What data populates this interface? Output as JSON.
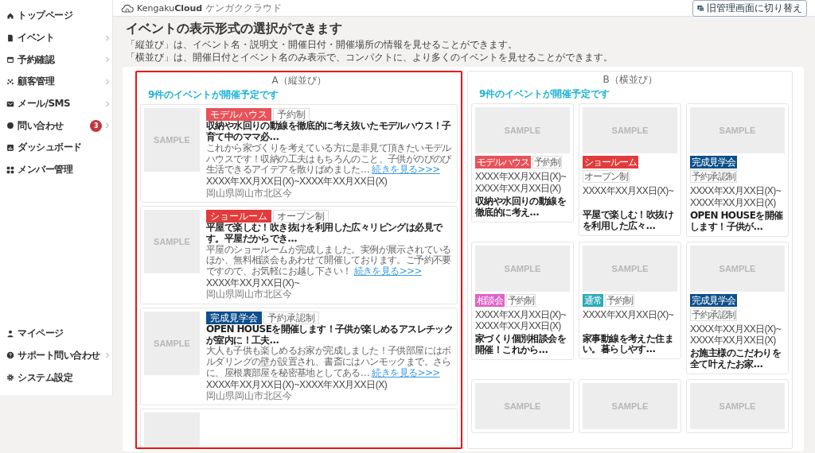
{
  "sidebar": {
    "items": [
      {
        "label": "トップページ",
        "expandable": false
      },
      {
        "label": "イベント",
        "expandable": true
      },
      {
        "label": "予約確認",
        "expandable": true
      },
      {
        "label": "顧客管理",
        "expandable": true
      },
      {
        "label": "メール/SMS",
        "expandable": true
      },
      {
        "label": "問い合わせ",
        "expandable": true,
        "badge": "3"
      },
      {
        "label": "ダッシュボード",
        "expandable": false
      },
      {
        "label": "メンバー管理",
        "expandable": false
      }
    ],
    "bottom_items": [
      {
        "label": "マイページ",
        "expandable": false
      },
      {
        "label": "サポート問い合わせ",
        "expandable": true
      },
      {
        "label": "システム設定",
        "expandable": false
      }
    ]
  },
  "header": {
    "logo": "Kengaku**Cloud**",
    "logo_sub": "ケンガククラウド",
    "switch_button": "旧管理画面に切り替え"
  },
  "page": {
    "title": "イベントの表示形式の選択ができます",
    "descriptions": [
      "「縦並び」は、イベント名・説明文・開催日付・開催場所の情報を見せることができます。",
      "「横並び」は、開催日付とイベント名のみ表示で、コンパクトに、より多くのイベントを見せることができます。"
    ]
  },
  "layouts": [
    {
      "kind": "vertical",
      "title": "A（縦並び）",
      "selected": true,
      "count_label": "9件のイベントが開催予定です",
      "cards": [
        {
          "image": {
            "kind": "placeholder",
            "label": "SAMPLE"
          },
          "tags": [
            {
              "kind": "filled",
              "label": "モデルハウス",
              "color": "#e8525a"
            },
            {
              "kind": "outline",
              "label": "予約制"
            }
          ],
          "title": "収納や水回りの動線を徹底的に考え抜いたモデルハウス！子育て中のママ必…",
          "description": "これから家づくりを考えている方に是非見て頂きたいモデルハウスです！収納の工夫はもちろんのこと、子供がのびのび生活できるアイデアを散りばめました…",
          "more_link": "続きを見る>>>",
          "dates": [
            "XXXX年XX月XX日(X)~XXXX年XX月XX日(X)"
          ],
          "place": "岡山県岡山市北区今"
        },
        {
          "image": {
            "kind": "placeholder",
            "label": "SAMPLE"
          },
          "tags": [
            {
              "kind": "filled",
              "label": "ショールーム",
              "color": "#e33b3b"
            },
            {
              "kind": "outline",
              "label": "オープン制"
            }
          ],
          "title": "平屋で楽しむ！吹き抜けを利用した広々リビングは必見です。平屋だからでき…",
          "description": "平屋のショールームが完成しました。実例が展示されているほか、無料相談会もあわせて開催しております。ご予約不要ですので、お気軽にお越し下さい！",
          "more_link": "続きを見る>>>",
          "dates": [
            "XXXX年XX月XX日(X)~"
          ],
          "place": "岡山県岡山市北区今"
        },
        {
          "image": {
            "kind": "placeholder",
            "label": "SAMPLE"
          },
          "tags": [
            {
              "kind": "filled",
              "label": "完成見学会",
              "color": "#0d4f8b"
            },
            {
              "kind": "outline",
              "label": "予約承認制"
            }
          ],
          "title": "OPEN HOUSEを開催します！子供が楽しめるアスレチックが室内に！工夫…",
          "description": "大人も子供も楽しめるお家が完成しました！子供部屋にはボルダリングの壁が設置され、書斎にはハンモックまで。さらに、屋根裏部屋を秘密基地としてある…",
          "more_link": "続きを見る>>>",
          "dates": [
            "XXXX年XX月XX日(X)~XXXX年XX月XX日(X)"
          ],
          "place": "岡山県岡山市北区今"
        },
        {
          "image": {
            "kind": "placeholder"
          }
        }
      ]
    },
    {
      "kind": "grid",
      "title": "B（横並び）",
      "selected": false,
      "count_label": "9件のイベントが開催予定です",
      "cards": [
        {
          "image": {
            "kind": "placeholder",
            "label": "SAMPLE"
          },
          "tags": [
            {
              "kind": "filled",
              "label": "モデルハウス",
              "color": "#e8525a"
            },
            {
              "kind": "outline",
              "label": "予約制"
            }
          ],
          "dates": [
            "XXXX年XX月XX日(X)~",
            "XXXX年XX月XX日(X)"
          ],
          "title": "収納や水回りの動線を徹底的に考え…"
        },
        {
          "image": {
            "kind": "placeholder",
            "label": "SAMPLE"
          },
          "tags": [
            {
              "kind": "filled",
              "label": "ショールーム",
              "color": "#e33b3b"
            },
            {
              "kind": "outline",
              "label": "オープン制"
            }
          ],
          "dates": [
            "XXXX年XX月XX日(X)~"
          ],
          "title": "平屋で楽しむ！吹抜けを利用した広々…"
        },
        {
          "image": {
            "kind": "placeholder",
            "label": "SAMPLE"
          },
          "tags": [
            {
              "kind": "filled",
              "label": "完成見学会",
              "color": "#0d4f8b"
            },
            {
              "kind": "outline",
              "label": "予約承認制"
            }
          ],
          "dates": [
            "XXXX年XX月XX日(X)~",
            "XXXX年XX月XX日(X)"
          ],
          "title": "OPEN HOUSEを開催します！子供が…"
        },
        {
          "image": {
            "kind": "placeholder",
            "label": "SAMPLE"
          },
          "tags": [
            {
              "kind": "filled",
              "label": "相談会",
              "color": "#e060c8"
            },
            {
              "kind": "outline",
              "label": "予約制"
            }
          ],
          "dates": [
            "XXXX年XX月XX日(X)~",
            "XXXX年XX月XX日(X)"
          ],
          "title": "家づくり個別相談会を開催！これから…"
        },
        {
          "image": {
            "kind": "placeholder",
            "label": "SAMPLE"
          },
          "tags": [
            {
              "kind": "filled",
              "label": "通常",
              "color": "#2aaab8"
            },
            {
              "kind": "outline",
              "label": "予約制"
            }
          ],
          "dates": [
            "XXXX年XX月XX日(X)~"
          ],
          "title": "家事動線を考えた住まい。暮らしやす…"
        },
        {
          "image": {
            "kind": "placeholder",
            "label": "SAMPLE"
          },
          "tags": [
            {
              "kind": "filled",
              "label": "完成見学会",
              "color": "#0d4f8b"
            },
            {
              "kind": "outline",
              "label": "予約承認制"
            }
          ],
          "dates": [
            "XXXX年XX月XX日(X)~",
            "XXXX年XX月XX日(X)"
          ],
          "title": "お施主様のこだわりを全て叶えたお家…"
        },
        {
          "image": {
            "kind": "placeholder",
            "label": "SAMPLE"
          }
        },
        {
          "image": {
            "kind": "placeholder",
            "label": "SAMPLE"
          }
        },
        {
          "image": {
            "kind": "placeholder",
            "label": "SAMPLE"
          }
        }
      ]
    }
  ]
}
